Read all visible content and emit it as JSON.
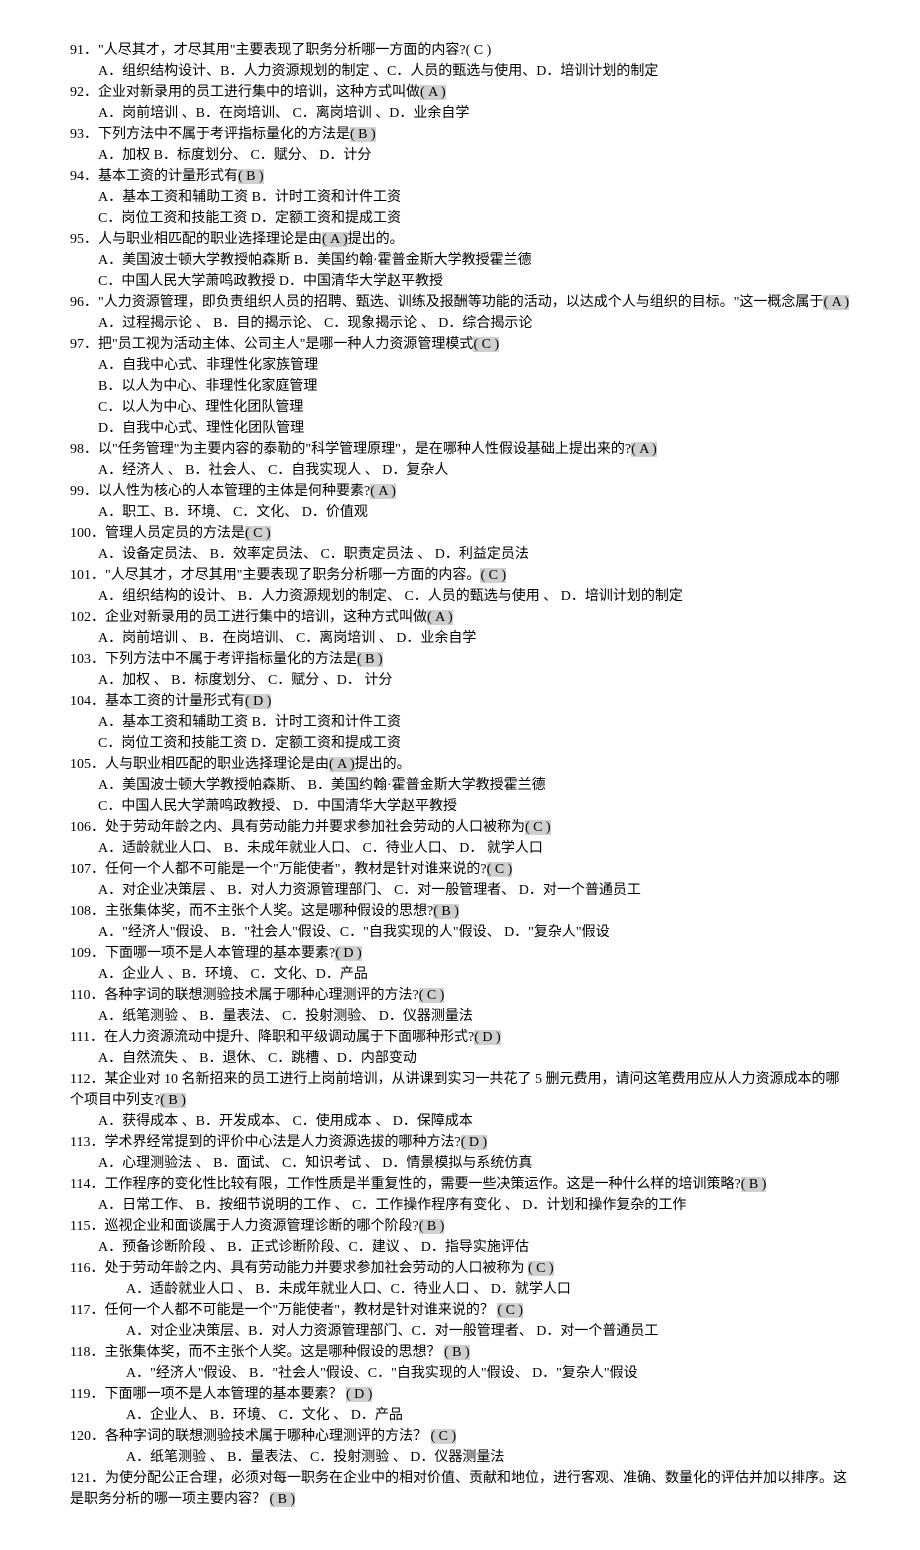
{
  "questions": [
    {
      "n": "91",
      "q": "．\"人尽其才，才尽其用\"主要表现了职务分析哪一方面的内容?( C )",
      "opts": [
        "A．组织结构设计、B．人力资源规划的制定 、C．人员的甄选与使用、D．培训计划的制定"
      ]
    },
    {
      "n": "92",
      "q": "．企业对新录用的员工进行集中的培训，这种方式叫做",
      "ans": "( A    )",
      "opts": [
        "A．岗前培训 、B．在岗培训、    C．离岗培训 、D．业余自学"
      ]
    },
    {
      "n": "93",
      "q": "．下列方法中不属于考评指标量化的方法是",
      "ans": "( B    )",
      "opts": [
        "A．加权    B．标度划分、  C．赋分、 D．计分"
      ]
    },
    {
      "n": "94",
      "q": "．基本工资的计量形式有",
      "ans": "( B    )",
      "opts": [
        "A．基本工资和辅助工资     B．计时工资和计件工资",
        "C．岗位工资和技能工资    D．定额工资和提成工资"
      ]
    },
    {
      "n": "95",
      "q": "．人与职业相匹配的职业选择理论是由",
      "ans": "( A    )",
      "tail": "提出的。",
      "opts": [
        "A．美国波士顿大学教授帕森斯    B．美国约翰·霍普金斯大学教授霍兰德",
        "C．中国人民大学萧鸣政教授    D．中国清华大学赵平教授"
      ]
    },
    {
      "n": "96",
      "q": "．\"人力资源管理，即负责组织人员的招聘、甄选、训练及报酬等功能的活动，以达成个人与组织的目标。\"这一概念属于",
      "ans": "( A )",
      "opts": [
        "A．过程揭示论 、 B．目的揭示论、    C．现象揭示论 、 D．综合揭示论"
      ]
    },
    {
      "n": "97",
      "q": "．把\"员工视为活动主体、公司主人\"是哪一种人力资源管理模式",
      "ans": "( C )",
      "opts": [
        "A．自我中心式、非理性化家族管理",
        "B．以人为中心、非理性化家庭管理",
        "C．以人为中心、理性化团队管理",
        "D．自我中心式、理性化团队管理"
      ]
    },
    {
      "n": "98",
      "q": "．以\"任务管理\"为主要内容的泰勒的\"科学管理原理\"，是在哪种人性假设基础上提出来的?",
      "ans": "( A )",
      "opts": [
        "A．经济人 、 B．社会人、    C．自我实现人 、 D．复杂人"
      ]
    },
    {
      "n": "99",
      "q": "．以人性为核心的人本管理的主体是何种要素?",
      "ans": "( A    )",
      "opts": [
        "A．职工、B．环境、    C．文化、 D．价值观"
      ]
    },
    {
      "n": "100",
      "q": "．管理人员定员的方法是",
      "ans": "( C    )",
      "opts": [
        "A．设备定员法、  B．效率定员法、    C．职责定员法 、 D．利益定员法"
      ]
    },
    {
      "n": "101",
      "q": "．\"人尽其才，才尽其用\"主要表现了职务分析哪一方面的内容。",
      "ans": "( C    )",
      "opts": [
        "A．组织结构的设计、 B．人力资源规划的制定、    C．人员的甄选与使用 、 D．培训计划的制定"
      ]
    },
    {
      "n": "102",
      "q": "．企业对新录用的员工进行集中的培训，这种方式叫做",
      "ans": "( A )",
      "opts": [
        "A．岗前培训 、 B．在岗培训、    C．离岗培训 、 D．业余自学"
      ]
    },
    {
      "n": "103",
      "q": "．下列方法中不属于考评指标量化的方法是",
      "ans": "( B    )",
      "opts": [
        "A．加权 、 B．标度划分、    C．赋分 、D． 计分"
      ]
    },
    {
      "n": "104",
      "q": "．基本工资的计量形式有",
      "ans": "( D    )",
      "opts": [
        "A．基本工资和辅助工资     B．计时工资和计件工资",
        "C．岗位工资和技能工资     D．定额工资和提成工资"
      ]
    },
    {
      "n": "105",
      "q": "．人与职业相匹配的职业选择理论是由",
      "ans": "( A )",
      "tail": "提出的。",
      "opts": [
        "A．美国波士顿大学教授帕森斯、  B．美国约翰·霍普金斯大学教授霍兰德",
        "C．中国人民大学萧鸣政教授、  D．中国清华大学赵平教授"
      ]
    },
    {
      "n": "106",
      "q": "．处于劳动年龄之内、具有劳动能力并要求参加社会劳动的人口被称为",
      "ans": "( C    )",
      "opts": [
        "A．适龄就业人口、  B．未成年就业人口、    C．待业人口、 D． 就学人口"
      ]
    },
    {
      "n": "107",
      "q": "．任何一个人都不可能是一个\"万能使者\"，教材是针对谁来说的?",
      "ans": "( C )",
      "opts": [
        "A．对企业决策层 、 B．对人力资源管理部门、    C．对一般管理者、 D．对一个普通员工"
      ]
    },
    {
      "n": "108",
      "q": "．主张集体奖，而不主张个人奖。这是哪种假设的思想?",
      "ans": "( B )",
      "opts": [
        "A．\"经济人\"假设、 B．\"社会人\"假设、C．\"自我实现的人\"假设、  D．\"复杂人\"假设"
      ]
    },
    {
      "n": "109",
      "q": "．下面哪一项不是人本管理的基本要素?",
      "ans": "( D )",
      "opts": [
        "A．企业人 、B．环境、    C．文化、D．产品"
      ]
    },
    {
      "n": "110",
      "q": "．各种字词的联想测验技术属于哪种心理测评的方法?",
      "ans": "( C    )",
      "opts": [
        "A．纸笔测验 、 B．量表法、    C．投射测验、 D．仪器测量法"
      ]
    },
    {
      "n": "111",
      "q": "．在人力资源流动中提升、降职和平级调动属于下面哪种形式?",
      "ans": "( D )",
      "opts": [
        "A．自然流失 、 B．退休、    C．跳槽 、D．内部变动"
      ]
    },
    {
      "n": "112",
      "q": "．某企业对 10 名新招来的员工进行上岗前培训，从讲课到实习一共花了 5 删元费用，请问这笔费用应从人力资源成本的哪个项目中列支?",
      "ans": "( B )",
      "opts": [
        "A．获得成本 、B．开发成本、    C．使用成本 、 D．保障成本"
      ]
    },
    {
      "n": "113",
      "q": "．学术界经常提到的评价中心法是人力资源选拔的哪种方法?",
      "ans": "( D     )",
      "opts": [
        "A．心理测验法 、 B．面试、    C．知识考试 、 D．情景模拟与系统仿真"
      ]
    },
    {
      "n": "114",
      "q": "．工作程序的变化性比较有限，工作性质是半重复性的，需要一些决策运作。这是一种什么样的培训策略?",
      "ans": "( B )",
      "opts": [
        "A．日常工作、 B．按细节说明的工作 、 C．工作操作程序有变化 、 D．计划和操作复杂的工作"
      ]
    },
    {
      "n": "115",
      "q": "．巡视企业和面谈属于人力资源管理诊断的哪个阶段?",
      "ans": "( B )",
      "opts": [
        "A．预备诊断阶段 、 B．正式诊断阶段、C．建议    、 D．指导实施评估"
      ]
    },
    {
      "n": "116",
      "q": "．处于劳动年龄之内、具有劳动能力并要求参加社会劳动的人口被称为 ",
      "ans": "( C )",
      "sub": true,
      "opts": [
        "A．适龄就业人口 、 B．未成年就业人口、C．待业人口 、 D．就学人口"
      ]
    },
    {
      "n": "117",
      "q": "．任何一个人都不可能是一个\"万能使者\"，教材是针对谁来说的？ ",
      "ans": "( C    )",
      "sub": true,
      "opts": [
        "A．对企业决策层、B．对人力资源管理部门、C．对一般管理者、 D．对一个普通员工"
      ]
    },
    {
      "n": "118",
      "q": "．主张集体奖，而不主张个人奖。这是哪种假设的思想？ ",
      "ans": "( B    )",
      "sub": true,
      "opts": [
        "A．\"经济人\"假设、 B．\"社会人\"假设、C．\"自我实现的人\"假设、 D．\"复杂人\"假设"
      ]
    },
    {
      "n": "119",
      "q": "．下面哪一项不是人本管理的基本要素？ ",
      "ans": "( D )",
      "sub": true,
      "opts": [
        "A．企业人、    B．环境、 C．文化    、 D．产品"
      ]
    },
    {
      "n": "120",
      "q": "．各种字词的联想测验技术属于哪种心理测评的方法？ ",
      "ans": "( C    )",
      "sub": true,
      "opts": [
        "A．纸笔测验 、 B．量表法、 C．投射测验 、 D．仪器测量法"
      ]
    },
    {
      "n": "121",
      "q": "．为使分配公正合理，必须对每一职务在企业中的相对价值、贡献和地位，进行客观、准确、数量化的评估并加以排序。这是职务分析的哪一项主要内容？ ",
      "ans": "( B )"
    }
  ]
}
